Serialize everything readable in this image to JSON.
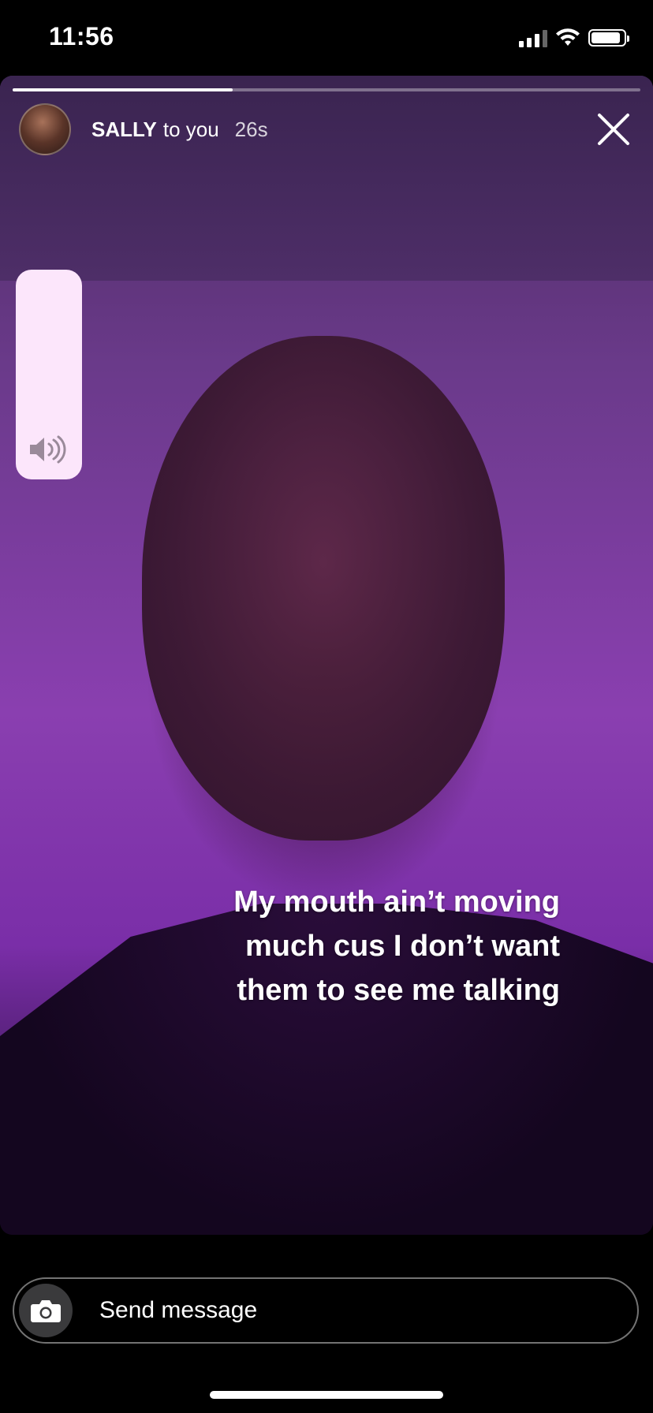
{
  "status_bar": {
    "time": "11:56",
    "icons": [
      "cellular-signal-icon",
      "wifi-icon",
      "battery-icon"
    ]
  },
  "story": {
    "progress": 0.35,
    "user": {
      "name": "SALLY",
      "recipient_text": "to you",
      "time_ago": "26s"
    },
    "volume_icon": "speaker-icon",
    "close_icon": "close-icon",
    "caption_lines": [
      "My mouth ain’t moving",
      "much cus I don’t want",
      "them to see me talking"
    ]
  },
  "composer": {
    "camera_icon": "camera-icon",
    "placeholder": "Send message"
  },
  "colors": {
    "background": "#000000",
    "story_tint": "#8a3fb0",
    "volume_panel": "#fce6fb"
  }
}
